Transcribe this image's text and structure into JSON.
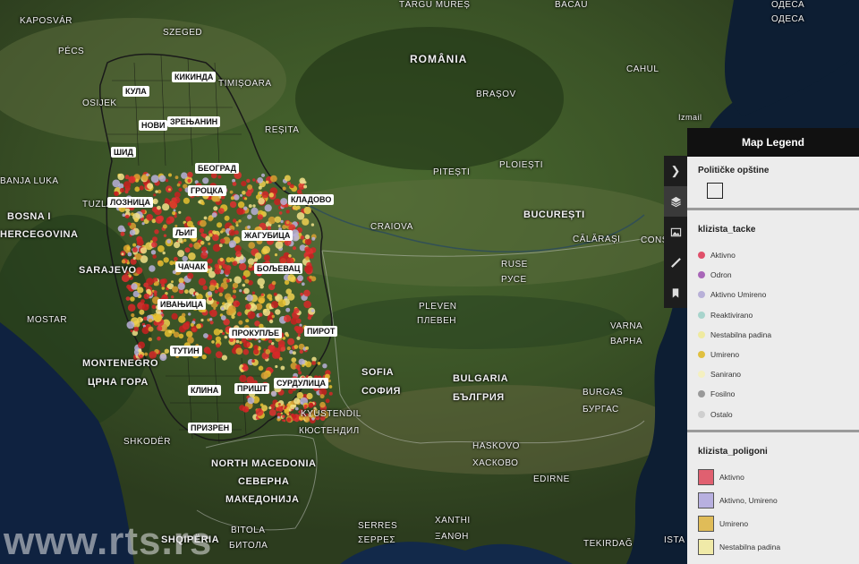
{
  "map_labels": {
    "kaposvar": "KAPOSVÁR",
    "pecs": "PÉCS",
    "osijek": "OSIJEK",
    "szeged": "SZEGED",
    "timisoara": "TIMIȘOARA",
    "resita": "REȘITA",
    "targu_mures": "TÂRGU MUREȘ",
    "romania": "ROMÂNIA",
    "bacau": "BACĂU",
    "odesa_1": "ОДЕСА",
    "odesa_2": "ОДЕСА",
    "brasov": "BRAȘOV",
    "cahul": "CAHUL",
    "izmail": "Izmail",
    "pitesti": "PITEȘTI",
    "ploiesti": "PLOIEȘTI",
    "craiova": "CRAIOVA",
    "bucuresti": "BUCUREȘTI",
    "calarasi": "CĂLĂRAȘI",
    "cons": "CONS",
    "ruse": "RUSE",
    "ruse_cyr": "РУСЕ",
    "pleven": "PLEVEN",
    "pleven_cyr": "ПЛЕВЕН",
    "varna": "VARNA",
    "varna_cyr": "ВАРНА",
    "banja_luka": "BANJA LUKA",
    "tuzla": "TUZLA",
    "bosna_1": "BOSNA I",
    "bosna_2": "HERCEGOVINA",
    "sarajevo": "SARAJEVO",
    "mostar": "MOSTAR",
    "montenegro": "MONTENEGRO",
    "montenegro_cyr": "ЦРНА ГОРА",
    "shkoder": "SHKODËR",
    "sofia": "SOFIA",
    "sofia_cyr": "СОФИЯ",
    "bulgaria": "BULGARIA",
    "bulgaria_cyr": "БЪЛГРИЯ",
    "burgas": "BURGAS",
    "burgas_cyr": "БУРГАС",
    "kyustendil": "KYUSTENDIL",
    "kyustendil_cyr": "КЮСТЕНДИЛ",
    "haskovo": "HASKOVO",
    "haskovo_cyr": "ХАСКОВО",
    "edirne": "EDIRNE",
    "north_macedonia": "NORTH MACEDONIA",
    "north_macedonia_cyr1": "СЕВЕРНА",
    "north_macedonia_cyr2": "МАКЕДОНИЈА",
    "shqiperia": "SHQIPËRIA",
    "bitola": "BITOLA",
    "bitola_cyr": "БИТОЛА",
    "serres": "SERRES",
    "serres_cyr": "ΣΕΡΡΕΣ",
    "xanthi": "XANTHI",
    "xanthi_cyr": "ΞΑΝΘΗ",
    "tekirdag": "TEKIRDAĞ",
    "ista": "ISTA"
  },
  "municipalities": {
    "kula": "КУЛА",
    "kikinda": "КИКИНДА",
    "novi": "НОВИ",
    "zrenjanin": "ЗРЕЊАНИН",
    "sid": "ШИД",
    "beograd": "БЕОГРАД",
    "grocka": "ГРОЦКА",
    "kladovo": "КЛАДОВО",
    "loznica": "ЛОЗНИЦА",
    "ljig": "ЉИГ",
    "zagubica": "ЖАГУБИЦА",
    "cacak": "ЧАЧАК",
    "boljevac": "БОЉЕВАЦ",
    "ivanjica": "ИВАЊИЦА",
    "prokuplje": "ПРОКУПЉЕ",
    "pirot": "ПИРОТ",
    "tutin": "ТУТИН",
    "klina": "КЛИНА",
    "pristina": "ПРИШТ",
    "surdulica": "СУРДУЛИЦА",
    "prizren": "ПРИЗРЕН"
  },
  "watermark": "www.rts.rs",
  "toolbar": {
    "items": [
      "chevron-right",
      "layers",
      "image",
      "ruler",
      "bookmark"
    ]
  },
  "legend": {
    "title": "Map Legend",
    "sections": {
      "opstine": {
        "title": "Političke opštine"
      },
      "tacke": {
        "title": "klizista_tacke",
        "items": [
          {
            "label": "Aktivno",
            "color": "#e0506a"
          },
          {
            "label": "Odron",
            "color": "#a866b8"
          },
          {
            "label": "Aktivno Umireno",
            "color": "#b8b0d8"
          },
          {
            "label": "Reaktivirano",
            "color": "#a8d4cc"
          },
          {
            "label": "Nestabilna padina",
            "color": "#efeaa0"
          },
          {
            "label": "Umireno",
            "color": "#e0c040"
          },
          {
            "label": "Sanirano",
            "color": "#f4f0c0"
          },
          {
            "label": "Fosilno",
            "color": "#999999"
          },
          {
            "label": "Ostalo",
            "color": "#cfcfcf"
          }
        ]
      },
      "poligoni": {
        "title": "klizista_poligoni",
        "items": [
          {
            "label": "Aktivno",
            "color": "#e06070"
          },
          {
            "label": "Aktivno, Umireno",
            "color": "#b8b0e0"
          },
          {
            "label": "Umireno",
            "color": "#e0bc58"
          },
          {
            "label": "Nestabilna padina",
            "color": "#f0eaa8"
          }
        ]
      }
    }
  }
}
